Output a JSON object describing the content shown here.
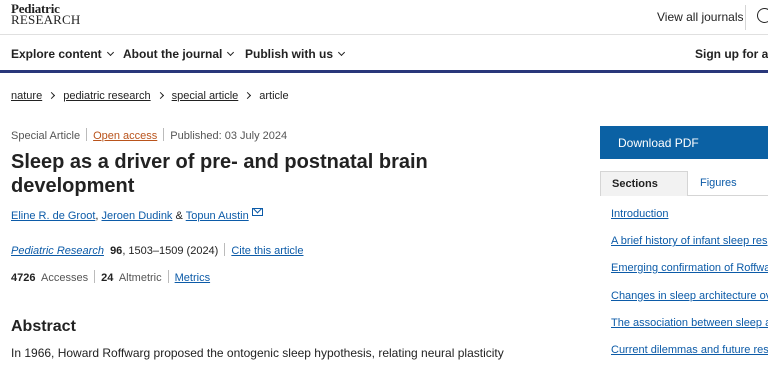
{
  "header": {
    "logo_line1": "Pediatric",
    "logo_line2": "RESEARCH",
    "view_all_journals": "View all journals",
    "search_icon": "search-icon"
  },
  "nav": {
    "items": [
      "Explore content",
      "About the journal",
      "Publish with us"
    ],
    "signup": "Sign up for ale",
    "accent_color": "#29377a"
  },
  "breadcrumb": [
    "nature",
    "pediatric research",
    "special article",
    "article"
  ],
  "article": {
    "type": "Special Article",
    "access": "Open access",
    "published": "Published: 03 July 2024",
    "title": "Sleep as a driver of pre- and postnatal brain development",
    "authors": [
      "Eline R. de Groot",
      "Jeroen Dudink",
      "Topun Austin"
    ],
    "author_sep": ", ",
    "author_and": " & ",
    "citation": {
      "journal": "Pediatric Research",
      "volume": "96",
      "pages": ", 1503–1509 (2024)",
      "cite_link": "Cite this article"
    },
    "metrics": {
      "accesses_value": "4726",
      "accesses_label": "Accesses",
      "altmetric_value": "24",
      "altmetric_label": "Altmetric",
      "metrics_link": "Metrics"
    },
    "abstract_heading": "Abstract",
    "abstract_text": "In 1966, Howard Roffwarg proposed the ontogenic sleep hypothesis, relating neural plasticity"
  },
  "sidebar": {
    "download_label": "Download PDF",
    "download_color": "#0b61a4",
    "tabs": [
      "Sections",
      "Figures"
    ],
    "sections": [
      "Introduction",
      "A brief history of infant sleep res",
      "Emerging confirmation of Roffwa",
      "Changes in sleep architecture ov",
      "The association between sleep a",
      "Current dilemmas and future res"
    ]
  }
}
